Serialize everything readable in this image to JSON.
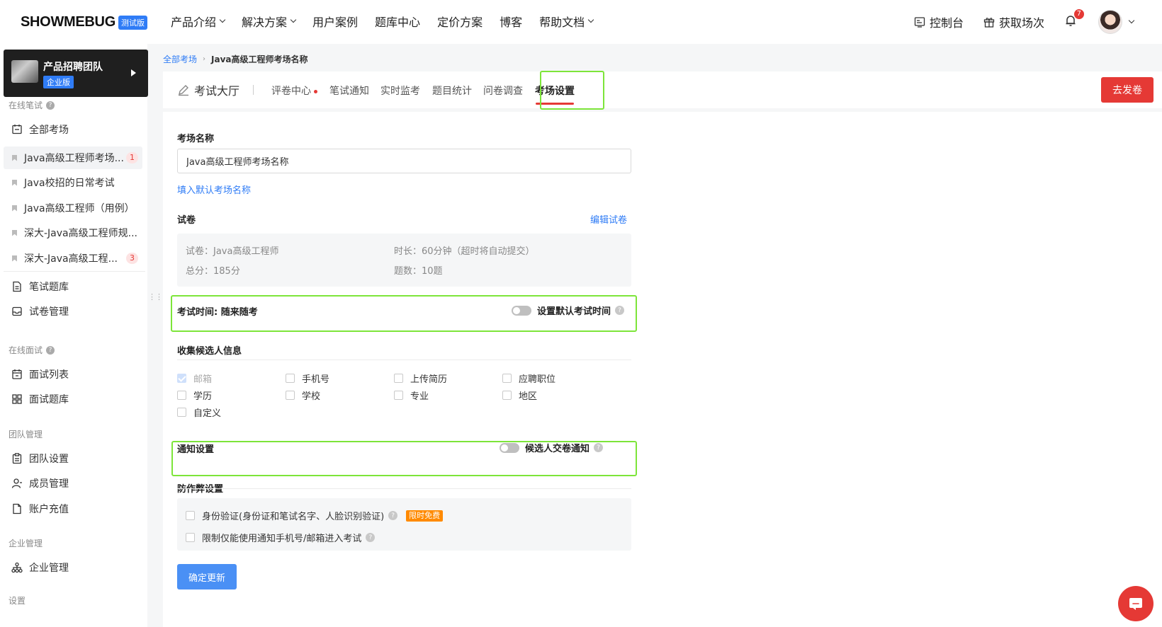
{
  "brand": {
    "logo": "SHOWMEBUG",
    "badge": "测试版"
  },
  "topnav": {
    "menu": [
      {
        "label": "产品介绍",
        "dropdown": true
      },
      {
        "label": "解决方案",
        "dropdown": true
      },
      {
        "label": "用户案例",
        "dropdown": false
      },
      {
        "label": "题库中心",
        "dropdown": false
      },
      {
        "label": "定价方案",
        "dropdown": false
      },
      {
        "label": "博客",
        "dropdown": false
      },
      {
        "label": "帮助文档",
        "dropdown": true
      }
    ],
    "console": "控制台",
    "get_sessions": "获取场次",
    "notification_count": "7"
  },
  "sidebar": {
    "team": {
      "name": "产品招聘团队",
      "tag": "企业版"
    },
    "written_section": "在线笔试",
    "all_exams": "全部考场",
    "exams": [
      {
        "label": "Java高级工程师考场...",
        "count": "1",
        "active": true
      },
      {
        "label": "Java校招的日常考试",
        "count": ""
      },
      {
        "label": "Java高级工程师（用例）",
        "count": ""
      },
      {
        "label": "深大-Java高级工程师规...",
        "count": ""
      },
      {
        "label": "深大-Java高级工程...",
        "count": "3"
      }
    ],
    "question_bank": "笔试题库",
    "paper_manage": "试卷管理",
    "interview_section": "在线面试",
    "interview_list": "面试列表",
    "interview_bank": "面试题库",
    "team_section": "团队管理",
    "team_settings": "团队设置",
    "members": "成员管理",
    "recharge": "账户充值",
    "enterprise_section": "企业管理",
    "enterprise_manage": "企业管理",
    "settings_section": "设置"
  },
  "breadcrumb": {
    "root": "全部考场",
    "current": "Java高级工程师考场名称"
  },
  "tabs": {
    "title": "考试大厅",
    "items": [
      {
        "label": "评卷中心",
        "dot": true
      },
      {
        "label": "笔试通知"
      },
      {
        "label": "实时监考"
      },
      {
        "label": "题目统计"
      },
      {
        "label": "问卷调查"
      },
      {
        "label": "考场设置",
        "active": true
      }
    ],
    "publish": "去发卷"
  },
  "form": {
    "name_label": "考场名称",
    "name_value": "Java高级工程师考场名称",
    "fill_default": "填入默认考场名称",
    "paper_label": "试卷",
    "edit_paper": "编辑试卷",
    "paper_name": "试卷：Java高级工程师",
    "duration": "时长：60分钟（超时将自动提交）",
    "total": "总分：185分",
    "questions": "题数：10题",
    "time_label": "考试时间: 随来随考",
    "time_switch": "设置默认考试时间",
    "collect_label": "收集候选人信息",
    "collect_options": [
      {
        "label": "邮箱",
        "checked": true
      },
      {
        "label": "手机号",
        "checked": false
      },
      {
        "label": "上传简历",
        "checked": false
      },
      {
        "label": "应聘职位",
        "checked": false
      },
      {
        "label": "学历",
        "checked": false
      },
      {
        "label": "学校",
        "checked": false
      },
      {
        "label": "专业",
        "checked": false
      },
      {
        "label": "地区",
        "checked": false
      },
      {
        "label": "自定义",
        "checked": false
      }
    ],
    "notify_label": "通知设置",
    "notify_switch": "候选人交卷通知",
    "cheat_label": "防作弊设置",
    "cheat_id": "身份验证(身份证和笔试名字、人脸识别验证)",
    "cheat_free": "限时免费",
    "cheat_limit": "限制仅能使用通知手机号/邮箱进入考试",
    "submit": "确定更新"
  },
  "colors": {
    "accent": "#e53935",
    "link": "#2f7cf6",
    "highlight": "#7de53a"
  }
}
